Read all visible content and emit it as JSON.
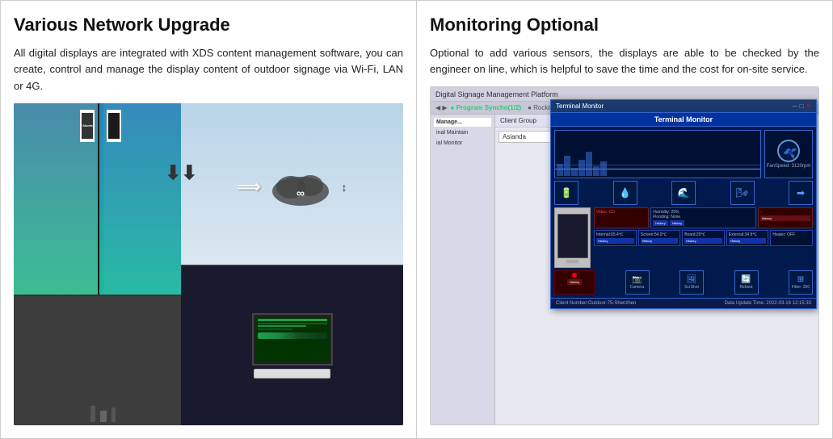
{
  "left": {
    "title": "Various Network Upgrade",
    "body": "All digital displays are integrated with XDS content management software, you can create, control and manage the display content of outdoor signage via Wi-Fi, LAN or 4G."
  },
  "right": {
    "title": "Monitoring Optional",
    "body": "Optional to add various sensors, the displays are able to be checked by the engineer on line, which is helpful to save the time and the cost for on-site service."
  },
  "software": {
    "title": "Digital Signage Management Platform",
    "nav_label": "Program Syncho(1/2)",
    "terminal_title": "Terminal Monitor",
    "terminal_header": "Terminal Monitor",
    "group_label": "Client Group",
    "client_name": "Asianda",
    "fan_speed": "FanSpeed: 3120rpm",
    "humidity": "Humidity: 25%",
    "flooding": "Flooding: None",
    "internal_temp": "Internal:65.4℃",
    "screen_temp": "Screen:54.9℃",
    "board_temp": "Board:25℃",
    "external_temp": "External:34.9℃",
    "heater": "Heater: OFF",
    "camera_label": "Camera",
    "screenshot_label": "ScrShot",
    "reboot_label": "Reboot",
    "filter_label": "Filter: 390",
    "footer_clients": "Client Number:Outdoor-75-Shenzhen",
    "footer_time": "Data Update Time: 2022-03-16 12:15:33",
    "sidebar_items": [
      "Manage...",
      "inal Maintain",
      "ial Monitor"
    ],
    "history_btn": "History"
  }
}
